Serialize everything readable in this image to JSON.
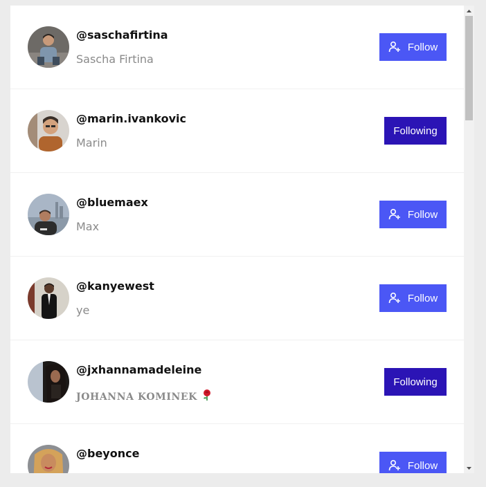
{
  "users": [
    {
      "handle": "@saschafirtina",
      "name": "Sascha Firtina",
      "button": "Follow",
      "state": "follow",
      "avatar": {
        "bg": "#6d6a66",
        "skin": "#c89a7a",
        "shirt": "#7f96ad",
        "hair": "#2b2521"
      }
    },
    {
      "handle": "@marin.ivankovic",
      "name": "Marin",
      "button": "Following",
      "state": "following",
      "avatar": {
        "bg": "#d8d4cf",
        "skin": "#d3a27d",
        "shirt": "#b0652e",
        "hair": "#3a2f28"
      }
    },
    {
      "handle": "@bluemaex",
      "name": "Max",
      "button": "Follow",
      "state": "follow",
      "avatar": {
        "bg": "#a9b6c6",
        "skin": "#b07d60",
        "shirt": "#2c2c2c",
        "hair": "#3b2e26"
      }
    },
    {
      "handle": "@kanyewest",
      "name": "ye",
      "button": "Follow",
      "state": "follow",
      "avatar": {
        "bg": "#d6d2c9",
        "skin": "#5a3b2b",
        "shirt": "#141414",
        "hair": "#1a1411"
      }
    },
    {
      "handle": "@jxhannamadeleine",
      "name": "JOHANNA KOMINEK",
      "name_emoji": "rose-icon",
      "button": "Following",
      "state": "following",
      "avatar": {
        "bg": "#b9c3cf",
        "skin": "#9a6a50",
        "shirt": "#1d1a18",
        "hair": "#1a1412"
      }
    },
    {
      "handle": "@beyonce",
      "name": "",
      "button": "Follow",
      "state": "follow",
      "avatar": {
        "bg": "#8d8f93",
        "skin": "#c88b5f",
        "shirt": "#e8e2d8",
        "hair": "#d4a25a"
      }
    }
  ],
  "colors": {
    "follow_button": "#4b57f5",
    "following_button": "#2b14b5",
    "handle_text": "#111111",
    "name_text": "#8a8a8a"
  },
  "icons": {
    "follow": "user-plus-icon",
    "scroll_up": "arrow-up-icon",
    "scroll_down": "arrow-down-icon"
  }
}
